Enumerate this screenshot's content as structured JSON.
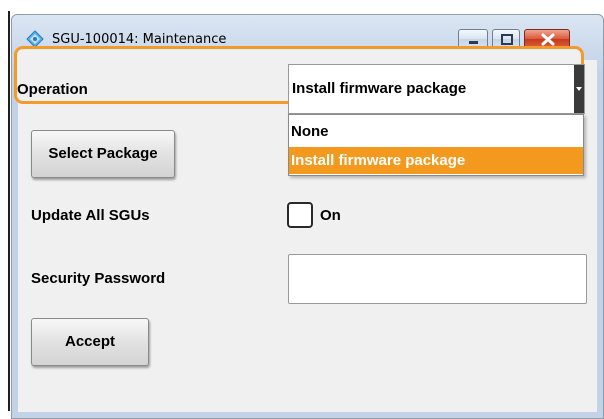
{
  "window": {
    "title": "SGU-100014: Maintenance",
    "title_icon": "diamond-app-icon",
    "controls": [
      "minimize-icon",
      "maximize-icon",
      "close-icon"
    ]
  },
  "operation": {
    "label": "Operation",
    "selected": "Install firmware package",
    "options": [
      "None",
      "Install firmware package"
    ]
  },
  "select_package_button": "Select Package",
  "update_all": {
    "label": "Update All SGUs",
    "checkbox_label": "On",
    "checked": false
  },
  "security_password": {
    "label": "Security Password",
    "value": ""
  },
  "accept_button": "Accept",
  "colors": {
    "accent_orange": "#f39a1e",
    "title_bar": "#c9d8ea",
    "panel": "#f0f0f0",
    "close_button": "#c7391a"
  }
}
